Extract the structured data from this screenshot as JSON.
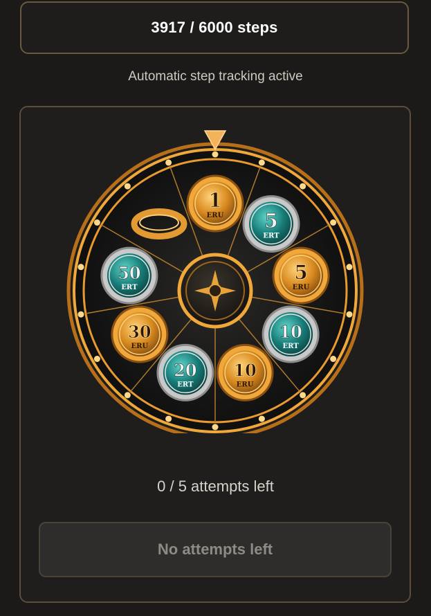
{
  "steps": {
    "label": "3917 / 6000 steps",
    "current": 3917,
    "goal": 6000
  },
  "tracking": {
    "status": "Automatic step tracking active"
  },
  "wheel": {
    "prizes": [
      {
        "value": "1",
        "currency": "ERU",
        "style": "gold"
      },
      {
        "value": "5",
        "currency": "ERT",
        "style": "teal"
      },
      {
        "value": "5",
        "currency": "ERU",
        "style": "gold"
      },
      {
        "value": "10",
        "currency": "ERT",
        "style": "teal"
      },
      {
        "value": "10",
        "currency": "ERU",
        "style": "gold"
      },
      {
        "value": "20",
        "currency": "ERT",
        "style": "teal"
      },
      {
        "value": "30",
        "currency": "ERU",
        "style": "gold"
      },
      {
        "value": "50",
        "currency": "ERT",
        "style": "teal"
      },
      {
        "value": "",
        "currency": "",
        "style": "ring"
      }
    ],
    "colors": {
      "gold": "#e6a23c",
      "teal": "#1f9a93",
      "dark": "#141414"
    }
  },
  "attempts": {
    "label": "0 / 5 attempts left",
    "used": 0,
    "total": 5
  },
  "spin_button": {
    "label": "No attempts left"
  }
}
